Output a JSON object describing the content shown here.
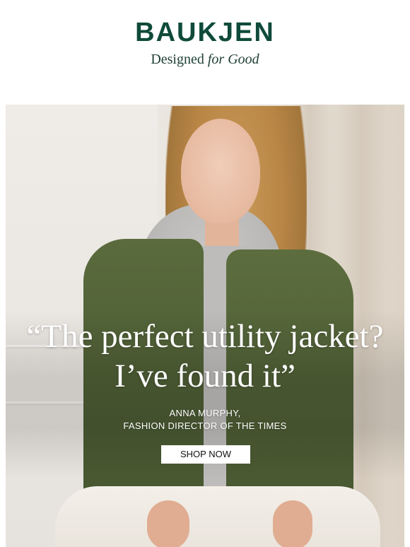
{
  "header": {
    "brand": "BAUKJEN",
    "tagline_start": "Designed ",
    "tagline_italic": "for Good"
  },
  "hero": {
    "quote_line1": "“The perfect utility jacket?",
    "quote_line2": "I’ve found it”",
    "attribution_line1": "ANNA MURPHY,",
    "attribution_line2": "FASHION DIRECTOR OF THE TIMES",
    "cta_label": "SHOP NOW"
  },
  "colors": {
    "brand_green": "#0f4a3a",
    "jacket_green": "#4d5d34",
    "cta_background": "#ffffff"
  }
}
